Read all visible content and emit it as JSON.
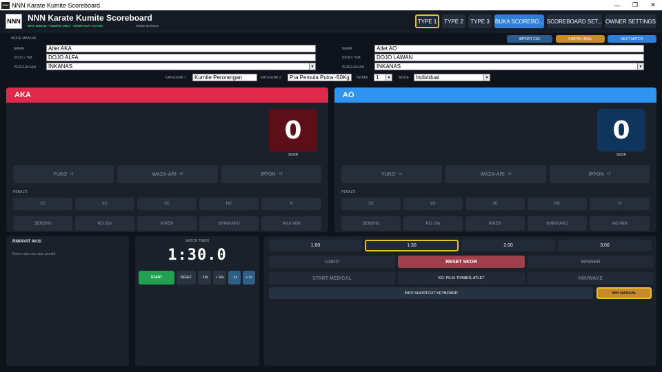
{
  "window": {
    "title": "NNN Karate Kumite Scoreboard",
    "icon_text": "NNN",
    "controls": [
      "—",
      "❐",
      "✕"
    ]
  },
  "header": {
    "logo_text": "NNN",
    "app_title": "NNN Karate Kumite Scoreboard",
    "subtitle": "WKF 2026.01 • KUMITE ONLY • SHORTCUT ACTIVE",
    "mode": "MODE MANUAL",
    "buttons": [
      "TYPE 1",
      "TYPE 2",
      "TYPE 3",
      "BUKA SCOREBO...",
      "SCOREBOARD SET...",
      "OWNER SETTINGS"
    ]
  },
  "toolbar": {
    "mode_label": "MODE MANUAL",
    "import_csv": "IMPORT CSV",
    "simpan_hasil": "SIMPAN HASIL",
    "next_match": "NEXT MATCH"
  },
  "form": {
    "aka": {
      "nama_label": "NAMA",
      "nama": "Atlet AKA",
      "dojo_label": "DOJO / TIM",
      "dojo": "DOJO ALFA",
      "perguruan_label": "PERGURUAN",
      "perguruan": "INKANAS"
    },
    "ao": {
      "nama_label": "NAMA",
      "nama": "Atlet AO",
      "dojo_label": "DOJO / TIM",
      "dojo": "DOJO LAWAN",
      "perguruan_label": "PERGURUAN",
      "perguruan": "INKANAS"
    },
    "kategori1_label": "KATEGORI 1",
    "kategori1": "Kumite Perorangan",
    "kategori2_label": "KATEGORI 2",
    "kategori2": "Pra Pemula Putra -50Kg",
    "tatami_label": "TATAMI",
    "tatami": "1",
    "mode_label": "MODE",
    "mode": "Individual"
  },
  "aka": {
    "name": "AKA",
    "score": "0",
    "skor_label": "SKOR",
    "yuko": "YUKO",
    "yuko_pts": "+1",
    "wazaari": "WAZA-ARI",
    "wazaari_pts": "+2",
    "ippon": "IPPON",
    "ippon_pts": "+3",
    "penalti_label": "PENALTI",
    "penalties": [
      "1C",
      "2C",
      "3C",
      "HC",
      "H"
    ],
    "actions": [
      "SENSHU",
      "KO 10s",
      "KIKEN",
      "SHIKKAKU",
      "AKA WIN"
    ]
  },
  "ao": {
    "name": "AO",
    "score": "0",
    "skor_label": "SKOR",
    "yuko": "YUKO",
    "yuko_pts": "+1",
    "wazaari": "WAZA-ARI",
    "wazaari_pts": "+2",
    "ippon": "IPPON",
    "ippon_pts": "+3",
    "penalti_label": "PENALTI",
    "penalties": [
      "1C",
      "2C",
      "3C",
      "HC",
      "H"
    ],
    "actions": [
      "SENSHU",
      "KO 10s",
      "KIKEN",
      "SHIKKAKU",
      "AO WIN"
    ]
  },
  "riwayat": {
    "title": "RIWAYAT AKSI",
    "empty": "Belum ada skor atau penalti."
  },
  "timer": {
    "title": "MATCH TIMER",
    "value": "1:30.0",
    "start": "START",
    "reset": "RESET",
    "adjust": [
      "- 10s",
      "+ 10s",
      "- 1s",
      "+ 1s"
    ]
  },
  "controls": {
    "presets": [
      "1:00",
      "1:30",
      "2:00",
      "3:00"
    ],
    "undo": "UNDO",
    "reset_skor": "RESET SKOR",
    "winner": "WINNER",
    "start_medical": "START MEDICAL",
    "ko_pilih": "KO: PILIH TOMBOL ATLET",
    "hikiwake": "HIKIWAKE",
    "info_shortcut": "INFO SHORTCUT KEYBOARD",
    "win_manual": "WIN MANUAL"
  },
  "colors": {
    "aka": "#e0294a",
    "ao": "#2f93f0",
    "accent": "#e6c12c",
    "blue_button": "#2f7ed9",
    "orange": "#c98a2a",
    "start_green": "#22a052"
  }
}
